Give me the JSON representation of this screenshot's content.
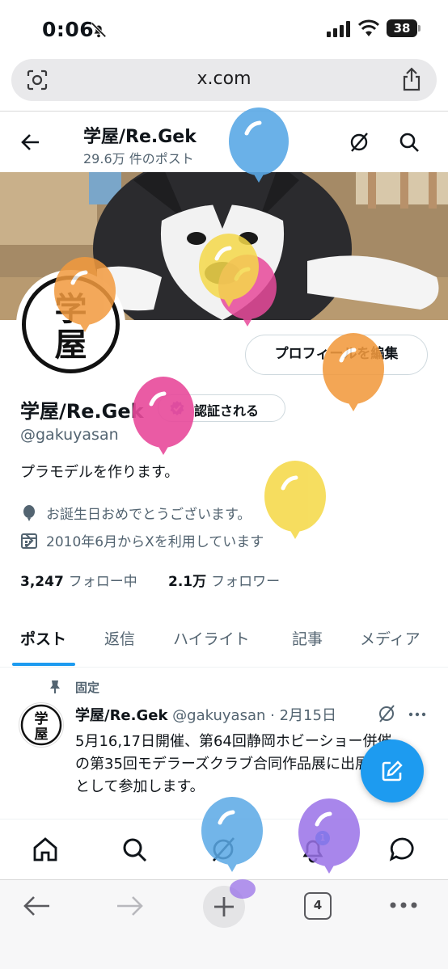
{
  "status_bar": {
    "time": "0:06",
    "battery": "38"
  },
  "browser": {
    "url": "x.com",
    "tab_count": "4"
  },
  "header": {
    "name": "学屋/Re.Gek",
    "post_count": "29.6万 件のポスト"
  },
  "profile": {
    "edit_label": "プロフィールを編集",
    "name": "学屋/Re.Gek",
    "verify_label": "認証される",
    "handle": "@gakuyasan",
    "bio": "プラモデルを作ります。",
    "birthday": "お誕生日おめでとうございます。",
    "joined": "2010年6月からXを利用しています",
    "following_count": "3,247",
    "following_label": "フォロー中",
    "followers_count": "2.1万",
    "followers_label": "フォロワー"
  },
  "tabs": [
    {
      "label": "ポスト"
    },
    {
      "label": "返信"
    },
    {
      "label": "ハイライト"
    },
    {
      "label": "記事"
    },
    {
      "label": "メディア"
    }
  ],
  "post": {
    "pinned_label": "固定",
    "author_name": "学屋/Re.Gek",
    "author_handle": "@gakuyasan",
    "separator": "·",
    "date": "2月15日",
    "lines": [
      "5月16,17日開催、第64回静岡ホビーショー併催",
      "の第35回モデラーズクラブ合同作品展に出展",
      "として参加します。"
    ]
  },
  "notifications": {
    "badge": "1"
  },
  "colors": {
    "accent": "#1d9bf0",
    "verified_badge": "#8a6fc9",
    "balloon_blue": "#5aa9e6",
    "balloon_yellow": "#f5d94a",
    "balloon_pink": "#e84a9b",
    "balloon_orange": "#f29a3e",
    "balloon_purple": "#9a72e8"
  },
  "icons": [
    "bell-off-icon",
    "signal-icon",
    "wifi-icon",
    "camera-search-icon",
    "share-icon",
    "back-arrow-icon",
    "grok-icon",
    "search-icon",
    "calendar-icon",
    "balloon-pin-icon",
    "chevron-right-icon",
    "pin-icon",
    "compose-icon",
    "home-icon",
    "notifications-icon",
    "messages-icon",
    "plus-icon",
    "more-icon"
  ]
}
